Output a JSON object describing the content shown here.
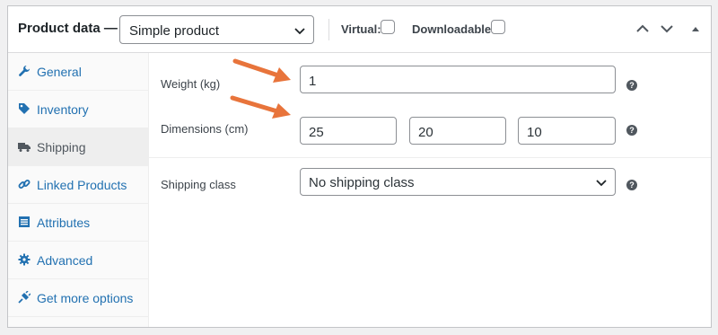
{
  "header": {
    "title": "Product data —",
    "product_type": "Simple product",
    "virtual_label": "Virtual:",
    "downloadable_label": "Downloadable:"
  },
  "sidebar": {
    "items": [
      {
        "label": "General",
        "icon": "wrench-icon"
      },
      {
        "label": "Inventory",
        "icon": "tag-icon"
      },
      {
        "label": "Shipping",
        "icon": "truck-icon",
        "active": true
      },
      {
        "label": "Linked Products",
        "icon": "link-icon"
      },
      {
        "label": "Attributes",
        "icon": "list-icon"
      },
      {
        "label": "Advanced",
        "icon": "gear-icon"
      },
      {
        "label": "Get more options",
        "icon": "plugin-icon"
      }
    ]
  },
  "shipping": {
    "weight_label": "Weight (kg)",
    "weight_value": "1",
    "dimensions_label": "Dimensions (cm)",
    "length_value": "25",
    "width_value": "20",
    "height_value": "10",
    "shipping_class_label": "Shipping class",
    "shipping_class_value": "No shipping class",
    "help_glyph": "?"
  },
  "colors": {
    "link": "#2271b1",
    "annotation_arrow": "#e8743b"
  }
}
